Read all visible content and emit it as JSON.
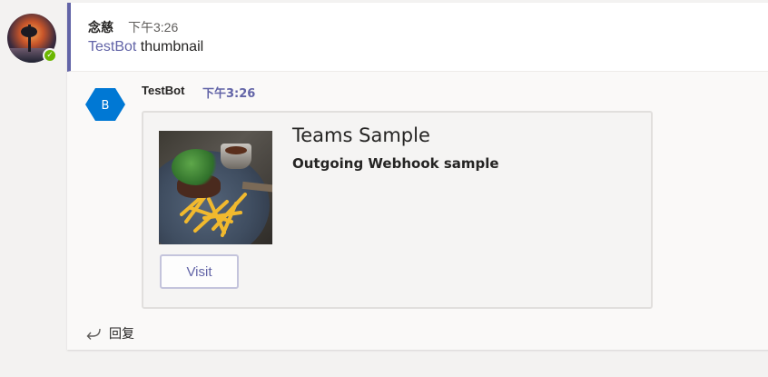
{
  "user": {
    "name": "念慈",
    "time": "下午3:26",
    "message_mention": "TestBot",
    "message_text": " thumbnail",
    "presence": "available"
  },
  "bot": {
    "avatar_letter": "B",
    "name": "TestBot",
    "time": "下午3:26"
  },
  "card": {
    "title": "Teams Sample",
    "subtitle": "Outgoing Webhook sample",
    "button_label": "Visit"
  },
  "reply": {
    "label": "回复"
  },
  "colors": {
    "accent": "#6264a7",
    "presence": "#6bb700",
    "bot_avatar": "#0078d4"
  },
  "icons": [
    "presence-check-icon",
    "bot-hexagon-icon",
    "reply-arrow-icon"
  ]
}
